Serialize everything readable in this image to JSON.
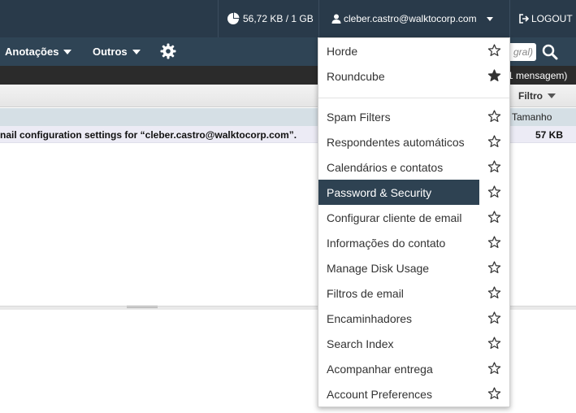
{
  "topbar": {
    "quota": "56,72 KB / 1 GB",
    "user": "cleber.castro@walktocorp.com",
    "logout": "LOGOUT"
  },
  "nav": {
    "items": [
      {
        "label": "Anotações"
      },
      {
        "label": "Outros"
      }
    ],
    "search_placeholder": "gral)"
  },
  "mailbox": {
    "message_count": "1 mensagem)",
    "filter_label": "Filtro",
    "column_size": "Tamanho",
    "message": {
      "subject": "nail configuration settings for “cleber.castro@walktocorp.com”.",
      "size": "57 KB"
    }
  },
  "menu": {
    "section1": [
      {
        "label": "Horde",
        "starred": false
      },
      {
        "label": "Roundcube",
        "starred": true
      }
    ],
    "section2": [
      {
        "label": "Spam Filters",
        "starred": false
      },
      {
        "label": "Respondentes automáticos",
        "starred": false
      },
      {
        "label": "Calendários e contatos",
        "starred": false
      },
      {
        "label": "Password & Security",
        "starred": false,
        "active": true
      },
      {
        "label": "Configurar cliente de email",
        "starred": false
      },
      {
        "label": "Informações do contato",
        "starred": false
      },
      {
        "label": "Manage Disk Usage",
        "starred": false
      },
      {
        "label": "Filtros de email",
        "starred": false
      },
      {
        "label": "Encaminhadores",
        "starred": false
      },
      {
        "label": "Search Index",
        "starred": false
      },
      {
        "label": "Acompanhar entrega",
        "starred": false
      },
      {
        "label": "Account Preferences",
        "starred": false
      }
    ]
  },
  "colors": {
    "topbar": "#293a4a",
    "navbar": "#2f4455",
    "menu_highlight": "#2e4252",
    "message_row": "#ecebf5"
  }
}
